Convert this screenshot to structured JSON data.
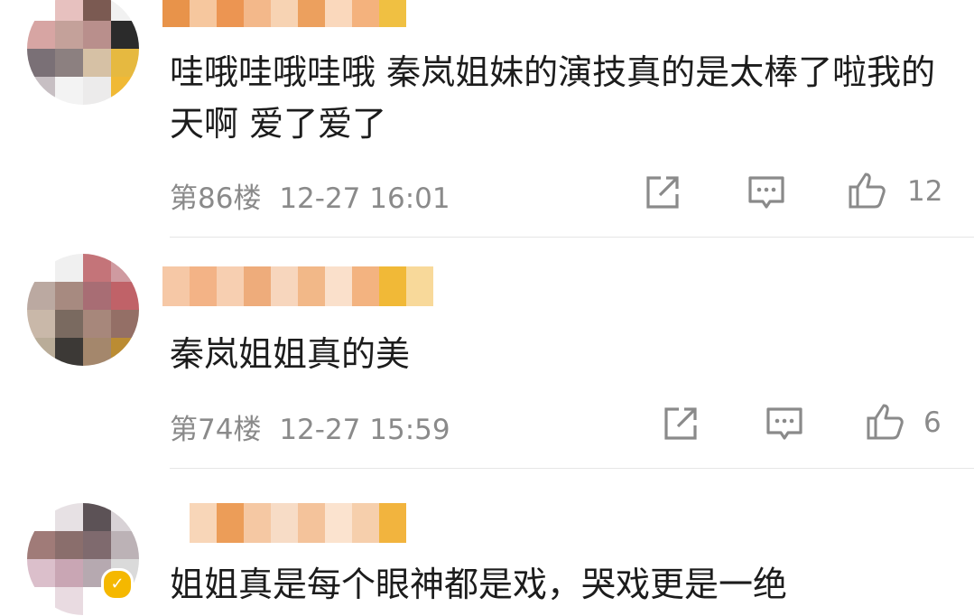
{
  "comments": [
    {
      "text": "哇哦哇哦哇哦 秦岚姐妹的演技真的是太棒了啦我的天啊 爱了爱了",
      "floor": "第86楼",
      "time": "12-27 16:01",
      "likes": "12",
      "verified": false,
      "avatar_colors": [
        "#ffffff",
        "#e7c1bf",
        "#7b5a52",
        "#f1f1f1",
        "#d7a5a3",
        "#c4a19a",
        "#b98f8c",
        "#2b2b2b",
        "#7a7076",
        "#8c8080",
        "#d6c1a5",
        "#e6b940",
        "#c7bfc3",
        "#f3f3f3",
        "#ecebeb",
        "#f0b935"
      ],
      "name_colors": [
        "#e8934a",
        "#f6c79e",
        "#ec9552",
        "#f3b88a",
        "#f7d3b3",
        "#eca05e",
        "#fad8bc",
        "#f4b27d",
        "#f0c042",
        "#ffffff"
      ]
    },
    {
      "text": "秦岚姐姐真的美",
      "floor": "第74楼",
      "time": "12-27 15:59",
      "likes": "6",
      "verified": false,
      "avatar_colors": [
        "#ffffff",
        "#f0f0f0",
        "#c47479",
        "#cf9aa0",
        "#bba9a1",
        "#a78a80",
        "#a86d74",
        "#c06268",
        "#c9b8a9",
        "#7a6a60",
        "#a7877b",
        "#946f66",
        "#b9ac98",
        "#3c3936",
        "#a4876c",
        "#bb8c33"
      ],
      "name_colors": [
        "#f6c8a6",
        "#f3b386",
        "#f7cfb1",
        "#eeac7b",
        "#f7d6bd",
        "#f2b888",
        "#fae0cb",
        "#f3b380",
        "#f1b937",
        "#f8d99a"
      ]
    },
    {
      "text": "姐姐真是每个眼神都是戏，哭戏更是一绝",
      "verified": true,
      "badge_symbol": "✓",
      "avatar_colors": [
        "#ffffff",
        "#e7e1e4",
        "#5c5256",
        "#d8d2d6",
        "#a07b78",
        "#8a6e6c",
        "#7f6a6e",
        "#bcb2b6",
        "#dbbfcb",
        "#c9a6b4",
        "#b6a9b0",
        "#dadada",
        "#ffffff",
        "#e9dbe1",
        "#ffffff",
        "#ffffff"
      ],
      "name_colors": [
        "#ffffff",
        "#f8d6b8",
        "#ec9d58",
        "#f5c8a3",
        "#f7dcc6",
        "#f4c39b",
        "#fbe3cf",
        "#f6cfac",
        "#f2b43e",
        "#ffffff"
      ]
    }
  ],
  "icons": {
    "share": "share-icon",
    "comment": "comment-icon",
    "like": "thumbs-up-icon"
  }
}
